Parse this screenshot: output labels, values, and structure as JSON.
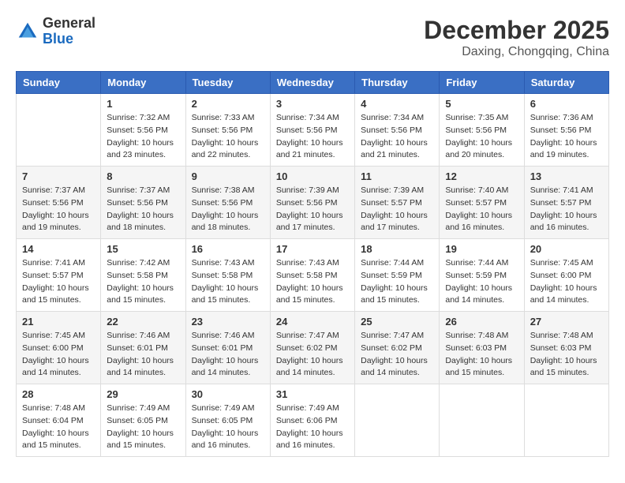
{
  "header": {
    "logo": {
      "general": "General",
      "blue": "Blue"
    },
    "title": "December 2025",
    "location": "Daxing, Chongqing, China"
  },
  "days_of_week": [
    "Sunday",
    "Monday",
    "Tuesday",
    "Wednesday",
    "Thursday",
    "Friday",
    "Saturday"
  ],
  "weeks": [
    [
      {
        "day": "",
        "sunrise": "",
        "sunset": "",
        "daylight": ""
      },
      {
        "day": "1",
        "sunrise": "Sunrise: 7:32 AM",
        "sunset": "Sunset: 5:56 PM",
        "daylight": "Daylight: 10 hours and 23 minutes."
      },
      {
        "day": "2",
        "sunrise": "Sunrise: 7:33 AM",
        "sunset": "Sunset: 5:56 PM",
        "daylight": "Daylight: 10 hours and 22 minutes."
      },
      {
        "day": "3",
        "sunrise": "Sunrise: 7:34 AM",
        "sunset": "Sunset: 5:56 PM",
        "daylight": "Daylight: 10 hours and 21 minutes."
      },
      {
        "day": "4",
        "sunrise": "Sunrise: 7:34 AM",
        "sunset": "Sunset: 5:56 PM",
        "daylight": "Daylight: 10 hours and 21 minutes."
      },
      {
        "day": "5",
        "sunrise": "Sunrise: 7:35 AM",
        "sunset": "Sunset: 5:56 PM",
        "daylight": "Daylight: 10 hours and 20 minutes."
      },
      {
        "day": "6",
        "sunrise": "Sunrise: 7:36 AM",
        "sunset": "Sunset: 5:56 PM",
        "daylight": "Daylight: 10 hours and 19 minutes."
      }
    ],
    [
      {
        "day": "7",
        "sunrise": "Sunrise: 7:37 AM",
        "sunset": "Sunset: 5:56 PM",
        "daylight": "Daylight: 10 hours and 19 minutes."
      },
      {
        "day": "8",
        "sunrise": "Sunrise: 7:37 AM",
        "sunset": "Sunset: 5:56 PM",
        "daylight": "Daylight: 10 hours and 18 minutes."
      },
      {
        "day": "9",
        "sunrise": "Sunrise: 7:38 AM",
        "sunset": "Sunset: 5:56 PM",
        "daylight": "Daylight: 10 hours and 18 minutes."
      },
      {
        "day": "10",
        "sunrise": "Sunrise: 7:39 AM",
        "sunset": "Sunset: 5:56 PM",
        "daylight": "Daylight: 10 hours and 17 minutes."
      },
      {
        "day": "11",
        "sunrise": "Sunrise: 7:39 AM",
        "sunset": "Sunset: 5:57 PM",
        "daylight": "Daylight: 10 hours and 17 minutes."
      },
      {
        "day": "12",
        "sunrise": "Sunrise: 7:40 AM",
        "sunset": "Sunset: 5:57 PM",
        "daylight": "Daylight: 10 hours and 16 minutes."
      },
      {
        "day": "13",
        "sunrise": "Sunrise: 7:41 AM",
        "sunset": "Sunset: 5:57 PM",
        "daylight": "Daylight: 10 hours and 16 minutes."
      }
    ],
    [
      {
        "day": "14",
        "sunrise": "Sunrise: 7:41 AM",
        "sunset": "Sunset: 5:57 PM",
        "daylight": "Daylight: 10 hours and 15 minutes."
      },
      {
        "day": "15",
        "sunrise": "Sunrise: 7:42 AM",
        "sunset": "Sunset: 5:58 PM",
        "daylight": "Daylight: 10 hours and 15 minutes."
      },
      {
        "day": "16",
        "sunrise": "Sunrise: 7:43 AM",
        "sunset": "Sunset: 5:58 PM",
        "daylight": "Daylight: 10 hours and 15 minutes."
      },
      {
        "day": "17",
        "sunrise": "Sunrise: 7:43 AM",
        "sunset": "Sunset: 5:58 PM",
        "daylight": "Daylight: 10 hours and 15 minutes."
      },
      {
        "day": "18",
        "sunrise": "Sunrise: 7:44 AM",
        "sunset": "Sunset: 5:59 PM",
        "daylight": "Daylight: 10 hours and 15 minutes."
      },
      {
        "day": "19",
        "sunrise": "Sunrise: 7:44 AM",
        "sunset": "Sunset: 5:59 PM",
        "daylight": "Daylight: 10 hours and 14 minutes."
      },
      {
        "day": "20",
        "sunrise": "Sunrise: 7:45 AM",
        "sunset": "Sunset: 6:00 PM",
        "daylight": "Daylight: 10 hours and 14 minutes."
      }
    ],
    [
      {
        "day": "21",
        "sunrise": "Sunrise: 7:45 AM",
        "sunset": "Sunset: 6:00 PM",
        "daylight": "Daylight: 10 hours and 14 minutes."
      },
      {
        "day": "22",
        "sunrise": "Sunrise: 7:46 AM",
        "sunset": "Sunset: 6:01 PM",
        "daylight": "Daylight: 10 hours and 14 minutes."
      },
      {
        "day": "23",
        "sunrise": "Sunrise: 7:46 AM",
        "sunset": "Sunset: 6:01 PM",
        "daylight": "Daylight: 10 hours and 14 minutes."
      },
      {
        "day": "24",
        "sunrise": "Sunrise: 7:47 AM",
        "sunset": "Sunset: 6:02 PM",
        "daylight": "Daylight: 10 hours and 14 minutes."
      },
      {
        "day": "25",
        "sunrise": "Sunrise: 7:47 AM",
        "sunset": "Sunset: 6:02 PM",
        "daylight": "Daylight: 10 hours and 14 minutes."
      },
      {
        "day": "26",
        "sunrise": "Sunrise: 7:48 AM",
        "sunset": "Sunset: 6:03 PM",
        "daylight": "Daylight: 10 hours and 15 minutes."
      },
      {
        "day": "27",
        "sunrise": "Sunrise: 7:48 AM",
        "sunset": "Sunset: 6:03 PM",
        "daylight": "Daylight: 10 hours and 15 minutes."
      }
    ],
    [
      {
        "day": "28",
        "sunrise": "Sunrise: 7:48 AM",
        "sunset": "Sunset: 6:04 PM",
        "daylight": "Daylight: 10 hours and 15 minutes."
      },
      {
        "day": "29",
        "sunrise": "Sunrise: 7:49 AM",
        "sunset": "Sunset: 6:05 PM",
        "daylight": "Daylight: 10 hours and 15 minutes."
      },
      {
        "day": "30",
        "sunrise": "Sunrise: 7:49 AM",
        "sunset": "Sunset: 6:05 PM",
        "daylight": "Daylight: 10 hours and 16 minutes."
      },
      {
        "day": "31",
        "sunrise": "Sunrise: 7:49 AM",
        "sunset": "Sunset: 6:06 PM",
        "daylight": "Daylight: 10 hours and 16 minutes."
      },
      {
        "day": "",
        "sunrise": "",
        "sunset": "",
        "daylight": ""
      },
      {
        "day": "",
        "sunrise": "",
        "sunset": "",
        "daylight": ""
      },
      {
        "day": "",
        "sunrise": "",
        "sunset": "",
        "daylight": ""
      }
    ]
  ]
}
